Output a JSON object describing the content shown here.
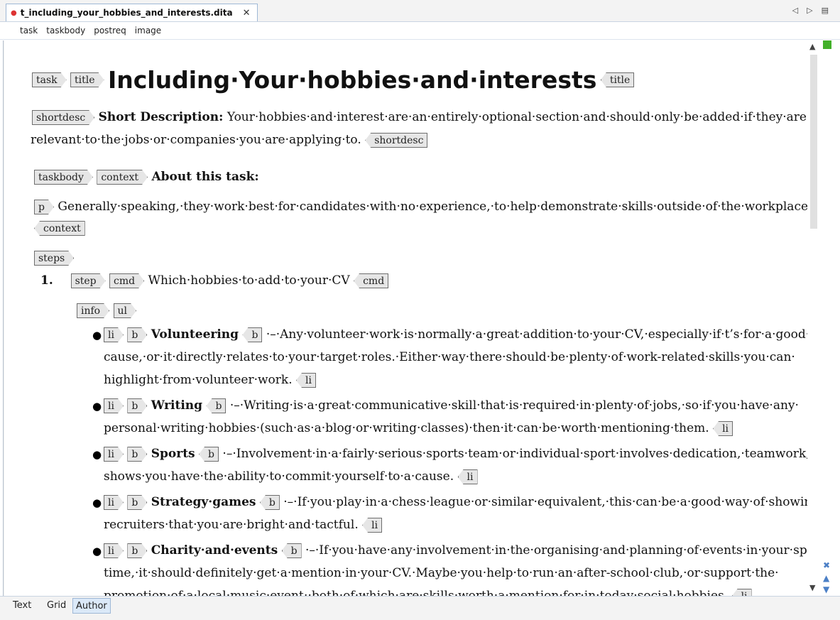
{
  "tab": {
    "filename": "t_including_your_hobbies_and_interests.dita",
    "close": "✕"
  },
  "breadcrumb": [
    "task",
    "taskbody",
    "postreq",
    "image"
  ],
  "tags": {
    "task": "task",
    "title": "title",
    "shortdesc": "shortdesc",
    "taskbody": "taskbody",
    "context": "context",
    "p": "p",
    "steps": "steps",
    "step": "step",
    "cmd": "cmd",
    "info": "info",
    "ul": "ul",
    "li": "li",
    "b": "b"
  },
  "doc": {
    "title": "Including·Your·hobbies·and·interests",
    "shortdesc_label": "Short Description:",
    "shortdesc_line1": "Your·hobbies·and·interest·are·an·entirely·optional·section·and·should·only·be·added·if·they·are·somehow·",
    "shortdesc_line2": "relevant·to·the·jobs·or·companies·you·are·applying·to.",
    "context_label": "About this task:",
    "context_p": "Generally·speaking,·they·work·best·for·candidates·with·no·experience,·to·help·demonstrate·skills·outside·of·the·workplace.",
    "step_number": "1.",
    "step_cmd": "Which·hobbies·to·add·to·your·CV",
    "items": [
      {
        "b": "Volunteering",
        "line1": "·–·Any·volunteer·work·is·normally·a·great·addition·to·your·CV,·especially·if·t’s·for·a·good·",
        "line2": "cause,·or·it·directly·relates·to·your·target·roles.·Either·way·there·should·be·plenty·of·work-related·skills·you·can·",
        "line3": "highlight·from·volunteer·work."
      },
      {
        "b": "Writing",
        "line1": "·–·Writing·is·a·great·communicative·skill·that·is·required·in·plenty·of·jobs,·so·if·you·have·any·",
        "line2": "personal·writing·hobbies·(such·as·a·blog·or·writing·classes)·then·it·can·be·worth·mentioning·them."
      },
      {
        "b": "Sports",
        "line1": "·–·Involvement·in·a·fairly·serious·sports·team·or·individual·sport·involves·dedication,·teamwork,·and·",
        "line2": "shows·you·have·the·ability·to·commit·yourself·to·a·cause."
      },
      {
        "b": "Strategy·games",
        "line1": "·–·If·you·play·in·a·chess·league·or·similar·equivalent,·this·can·be·a·good·way·of·showing·",
        "line2": "recruiters·that·you·are·bright·and·tactful."
      },
      {
        "b": "Charity·and·events",
        "line1": "·–·If·you·have·any·involvement·in·the·organising·and·planning·of·events·in·your·spare·",
        "line2": "time,·it·should·definitely·get·a·mention·in·your·CV.·Maybe·you·help·to·run·an·after-school·club,·or·support·the·",
        "line3": "promotion·of·a·local·music·event;·both·of·which·are·skills·worth·a·mention·for·in·today·social·hobbies."
      }
    ]
  },
  "bottom_tabs": [
    "Text",
    "Grid",
    "Author"
  ],
  "colors": {
    "accent": "#43b02a",
    "tag_bg": "#e6e6e6",
    "tab_active": "#dbe9f8"
  }
}
